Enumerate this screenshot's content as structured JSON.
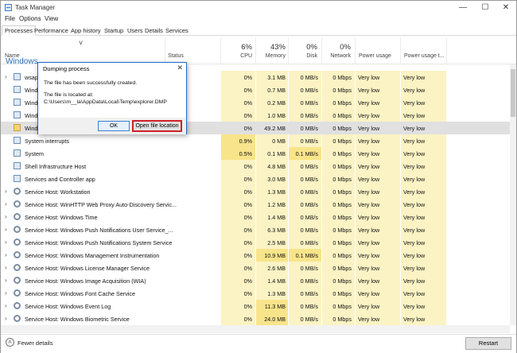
{
  "window": {
    "title": "Task Manager"
  },
  "window_controls": {
    "minimize": "—",
    "maximize": "☐",
    "close": "✕"
  },
  "menu": [
    "File",
    "Options",
    "View"
  ],
  "tabs": [
    "Processes",
    "Performance",
    "App history",
    "Startup",
    "Users",
    "Details",
    "Services"
  ],
  "header": {
    "name": "Name",
    "status": "Status",
    "cpu_pct": "6%",
    "cpu": "CPU",
    "mem_pct": "43%",
    "mem": "Memory",
    "disk_pct": "0%",
    "disk": "Disk",
    "net_pct": "0%",
    "net": "Network",
    "power": "Power usage",
    "power_trend": "Power usage t...",
    "sort_arrow": "˅"
  },
  "group_label": "Windows",
  "rows": [
    {
      "chev": "›",
      "icon": "app",
      "name": "wsapp",
      "cpu": "0%",
      "mem": "3.1 MB",
      "disk": "0 MB/s",
      "net": "0 Mbps",
      "power": "Very low",
      "trend": "Very low"
    },
    {
      "chev": "",
      "icon": "sys",
      "name": "Windo",
      "cpu": "0%",
      "mem": "0.7 MB",
      "disk": "0 MB/s",
      "net": "0 Mbps",
      "power": "Very low",
      "trend": "Very low"
    },
    {
      "chev": "",
      "icon": "sys",
      "name": "Windo",
      "cpu": "0%",
      "mem": "0.2 MB",
      "disk": "0 MB/s",
      "net": "0 Mbps",
      "power": "Very low",
      "trend": "Very low"
    },
    {
      "chev": "",
      "icon": "sys",
      "name": "Windo",
      "cpu": "0%",
      "mem": "1.0 MB",
      "disk": "0 MB/s",
      "net": "0 Mbps",
      "power": "Very low",
      "trend": "Very low"
    },
    {
      "chev": "",
      "icon": "folder",
      "name": "Windo",
      "cpu": "0%",
      "mem": "49.2 MB",
      "disk": "0 MB/s",
      "net": "0 Mbps",
      "power": "Very low",
      "trend": "Very low",
      "selected": true
    },
    {
      "chev": "",
      "icon": "sys",
      "name": "System interrupts",
      "cpu": "0.9%",
      "mem": "0 MB",
      "disk": "0 MB/s",
      "net": "0 Mbps",
      "power": "Very low",
      "trend": "Very low"
    },
    {
      "chev": "",
      "icon": "sys",
      "name": "System",
      "cpu": "0.5%",
      "mem": "0.1 MB",
      "disk": "0.1 MB/s",
      "net": "0 Mbps",
      "power": "Very low",
      "trend": "Very low"
    },
    {
      "chev": "",
      "icon": "sys",
      "name": "Shell Infrastructure Host",
      "cpu": "0%",
      "mem": "4.8 MB",
      "disk": "0 MB/s",
      "net": "0 Mbps",
      "power": "Very low",
      "trend": "Very low"
    },
    {
      "chev": "",
      "icon": "sys",
      "name": "Services and Controller app",
      "cpu": "0%",
      "mem": "3.0 MB",
      "disk": "0 MB/s",
      "net": "0 Mbps",
      "power": "Very low",
      "trend": "Very low"
    },
    {
      "chev": "›",
      "icon": "gear",
      "name": "Service Host: Workstation",
      "cpu": "0%",
      "mem": "1.3 MB",
      "disk": "0 MB/s",
      "net": "0 Mbps",
      "power": "Very low",
      "trend": "Very low"
    },
    {
      "chev": "›",
      "icon": "gear",
      "name": "Service Host: WinHTTP Web Proxy Auto-Discovery Servic...",
      "cpu": "0%",
      "mem": "1.2 MB",
      "disk": "0 MB/s",
      "net": "0 Mbps",
      "power": "Very low",
      "trend": "Very low"
    },
    {
      "chev": "›",
      "icon": "gear",
      "name": "Service Host: Windows Time",
      "cpu": "0%",
      "mem": "1.4 MB",
      "disk": "0 MB/s",
      "net": "0 Mbps",
      "power": "Very low",
      "trend": "Very low"
    },
    {
      "chev": "›",
      "icon": "gear",
      "name": "Service Host: Windows Push Notifications User Service_...",
      "cpu": "0%",
      "mem": "6.3 MB",
      "disk": "0 MB/s",
      "net": "0 Mbps",
      "power": "Very low",
      "trend": "Very low"
    },
    {
      "chev": "›",
      "icon": "gear",
      "name": "Service Host: Windows Push Notifications System Service",
      "cpu": "0%",
      "mem": "2.5 MB",
      "disk": "0 MB/s",
      "net": "0 Mbps",
      "power": "Very low",
      "trend": "Very low"
    },
    {
      "chev": "›",
      "icon": "gear",
      "name": "Service Host: Windows Management Instrumentation",
      "cpu": "0%",
      "mem": "10.9 MB",
      "disk": "0.1 MB/s",
      "net": "0 Mbps",
      "power": "Very low",
      "trend": "Very low"
    },
    {
      "chev": "›",
      "icon": "gear",
      "name": "Service Host: Windows License Manager Service",
      "cpu": "0%",
      "mem": "2.6 MB",
      "disk": "0 MB/s",
      "net": "0 Mbps",
      "power": "Very low",
      "trend": "Very low"
    },
    {
      "chev": "›",
      "icon": "gear",
      "name": "Service Host: Windows Image Acquisition (WIA)",
      "cpu": "0%",
      "mem": "1.4 MB",
      "disk": "0 MB/s",
      "net": "0 Mbps",
      "power": "Very low",
      "trend": "Very low"
    },
    {
      "chev": "›",
      "icon": "gear",
      "name": "Service Host: Windows Font Cache Service",
      "cpu": "0%",
      "mem": "1.3 MB",
      "disk": "0 MB/s",
      "net": "0 Mbps",
      "power": "Very low",
      "trend": "Very low"
    },
    {
      "chev": "›",
      "icon": "gear",
      "name": "Service Host: Windows Event Log",
      "cpu": "0%",
      "mem": "11.3 MB",
      "disk": "0 MB/s",
      "net": "0 Mbps",
      "power": "Very low",
      "trend": "Very low"
    },
    {
      "chev": "›",
      "icon": "gear",
      "name": "Service Host: Windows Biometric Service",
      "cpu": "0%",
      "mem": "24.0 MB",
      "disk": "0 MB/s",
      "net": "0 Mbps",
      "power": "Very low",
      "trend": "Very low"
    }
  ],
  "dialog": {
    "title": "Dumping process",
    "close": "✕",
    "line1": "The file has been successfully created.",
    "line2": "The file is located at:",
    "line3": "C:\\Users\\m__la\\AppData\\Local\\Temp\\explorer.DMP",
    "ok": "OK",
    "open_location": "Open file location"
  },
  "footer": {
    "fewer": "Fewer details",
    "fewer_icon": "˄",
    "restart": "Restart"
  },
  "colors": {
    "accent": "#1a6fd0",
    "highlight": "#d0202a",
    "heat": "#fbf3c4"
  }
}
